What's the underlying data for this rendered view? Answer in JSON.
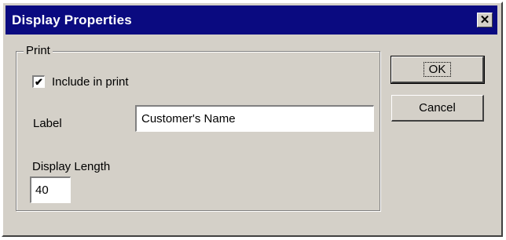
{
  "window": {
    "title": "Display Properties",
    "close_glyph": "✕"
  },
  "print_group": {
    "title": "Print",
    "include_checkbox": {
      "label": "Include in print",
      "checked": true,
      "check_glyph": "✔"
    },
    "label_field": {
      "label": "Label",
      "value": "Customer's Name"
    },
    "display_length": {
      "label": "Display Length",
      "value": "40"
    }
  },
  "buttons": {
    "ok": "OK",
    "cancel": "Cancel"
  },
  "icons": {
    "close": "close-icon",
    "check": "checkmark-icon"
  }
}
